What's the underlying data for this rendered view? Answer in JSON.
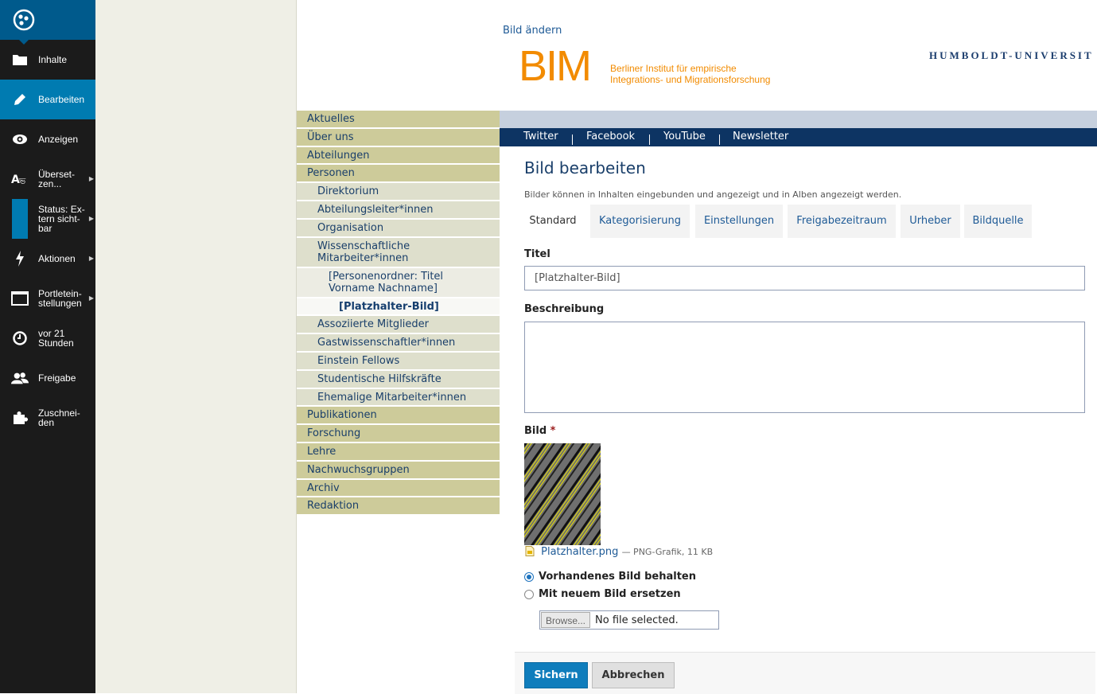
{
  "toolbar": {
    "items": [
      {
        "label": "Inhalte",
        "icon": "folder-icon"
      },
      {
        "label": "Bearbeiten",
        "icon": "pencil-icon",
        "active": true
      },
      {
        "label": "Anzeigen",
        "icon": "eye-icon"
      },
      {
        "label": "Überset-\nzen...",
        "icon": "translate-icon",
        "submenu": true
      },
      {
        "label": "Status: Ex-\ntern sicht-\nbar",
        "icon": "status-icon",
        "submenu": true
      },
      {
        "label": "Aktionen",
        "icon": "bolt-icon",
        "submenu": true
      },
      {
        "label": "Portletein-\nstellungen",
        "icon": "window-icon",
        "submenu": true
      },
      {
        "label": "vor 21\nStunden",
        "icon": "clock-icon"
      },
      {
        "label": "Freigabe",
        "icon": "users-icon"
      },
      {
        "label": "Zuschnei-\nden",
        "icon": "puzzle-icon"
      }
    ]
  },
  "header": {
    "bild_aendern": "Bild ändern",
    "bim_logo": "BIM",
    "bim_subtitle": "Berliner Institut für empirische\nIntegrations- und Migrationsforschung",
    "hu_logo": "HUMBOLDT-UNIVERSIT"
  },
  "leftnav": [
    {
      "label": "Aktuelles",
      "level": 0
    },
    {
      "label": "Über uns",
      "level": 0
    },
    {
      "label": "Abteilungen",
      "level": 0
    },
    {
      "label": "Personen",
      "level": 0
    },
    {
      "label": "Direktorium",
      "level": 1
    },
    {
      "label": "Abteilungsleiter*innen",
      "level": 1
    },
    {
      "label": "Organisation",
      "level": 1
    },
    {
      "label": "Wissenschaftliche\nMitarbeiter*innen",
      "level": 1
    },
    {
      "label": "[Personenordner: Titel\nVorname Nachname]",
      "level": 2
    },
    {
      "label": "[Platzhalter-Bild]",
      "level": 3
    },
    {
      "label": "Assoziierte Mitglieder",
      "level": 1
    },
    {
      "label": "Gastwissenschaftler*innen",
      "level": 1
    },
    {
      "label": "Einstein Fellows",
      "level": 1
    },
    {
      "label": "Studentische Hilfskräfte",
      "level": 1
    },
    {
      "label": "Ehemalige Mitarbeiter*innen",
      "level": 1
    },
    {
      "label": "Publikationen",
      "level": 0
    },
    {
      "label": "Forschung",
      "level": 0
    },
    {
      "label": "Lehre",
      "level": 0
    },
    {
      "label": "Nachwuchsgruppen",
      "level": 0
    },
    {
      "label": "Archiv",
      "level": 0
    },
    {
      "label": "Redaktion",
      "level": 0
    }
  ],
  "social": [
    "Twitter",
    "Facebook",
    "YouTube",
    "Newsletter"
  ],
  "main": {
    "title": "Bild bearbeiten",
    "description": "Bilder können in Inhalten eingebunden und angezeigt und in Alben angezeigt werden.",
    "tabs": [
      "Standard",
      "Kategorisierung",
      "Einstellungen",
      "Freigabezeitraum",
      "Urheber",
      "Bildquelle"
    ],
    "active_tab": "Standard"
  },
  "form": {
    "titel_label": "Titel",
    "titel_value": "[Platzhalter-Bild]",
    "beschreibung_label": "Beschreibung",
    "beschreibung_value": "",
    "bild_label": "Bild",
    "required_marker": "*",
    "file_name": "Platzhalter.png",
    "file_meta": "— PNG-Grafik, 11 KB",
    "radio_keep": "Vorhandenes Bild behalten",
    "radio_replace": "Mit neuem Bild ersetzen",
    "browse_label": "Browse...",
    "no_file": "No file selected.",
    "save": "Sichern",
    "cancel": "Abbrechen"
  },
  "colors": {
    "toolbar_bg": "#1b1b1b",
    "toolbar_active": "#007bb1",
    "nav_primary": "#cdcb9a",
    "bim_orange": "#f28b00",
    "social_bar": "#0d3463",
    "save_button": "#0f7dbc"
  }
}
